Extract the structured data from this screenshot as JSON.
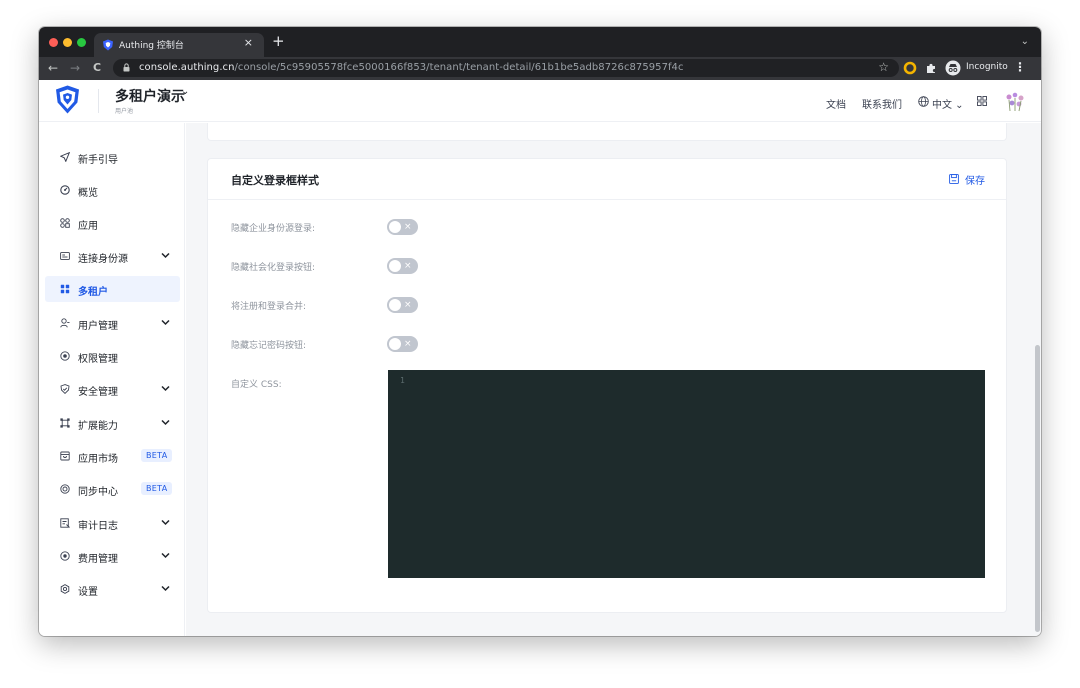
{
  "browser": {
    "tab_title": "Authing 控制台",
    "tab_close": "×",
    "new_tab": "+",
    "tab_menu": "⌄",
    "back": "←",
    "forward": "→",
    "reload": "C",
    "url_host": "console.authing.cn",
    "url_path": "/console/5c95905578fce5000166f853/tenant/tenant-detail/61b1be5adb8726c875957f4c",
    "bookmark_star": "☆",
    "incognito_label": "Incognito",
    "menu": "⋮"
  },
  "header": {
    "pool_name": "多租户演示",
    "pool_caret": "⌄",
    "pool_sub": "用户池",
    "docs_link": "文档",
    "contact_link": "联系我们",
    "language": "中文 ⌄"
  },
  "sidebar": {
    "items": [
      {
        "label": "新手引导",
        "icon": "send-icon"
      },
      {
        "label": "概览",
        "icon": "dashboard-icon"
      },
      {
        "label": "应用",
        "icon": "apps-icon"
      },
      {
        "label": "连接身份源",
        "icon": "id-card-icon",
        "expandable": true
      },
      {
        "label": "多租户",
        "icon": "grid-icon",
        "active": true
      },
      {
        "label": "用户管理",
        "icon": "users-icon",
        "expandable": true
      },
      {
        "label": "权限管理",
        "icon": "target-icon"
      },
      {
        "label": "安全管理",
        "icon": "shield-icon",
        "expandable": true
      },
      {
        "label": "扩展能力",
        "icon": "extend-icon",
        "expandable": true
      },
      {
        "label": "应用市场",
        "icon": "store-icon",
        "badge": "BETA"
      },
      {
        "label": "同步中心",
        "icon": "sync-icon",
        "badge": "BETA"
      },
      {
        "label": "审计日志",
        "icon": "log-icon",
        "expandable": true
      },
      {
        "label": "费用管理",
        "icon": "coin-icon",
        "expandable": true
      },
      {
        "label": "设置",
        "icon": "gear-icon",
        "expandable": true
      }
    ]
  },
  "card": {
    "title": "自定义登录框样式",
    "save_label": "保存",
    "fields": [
      {
        "label": "隐藏企业身份源登录:",
        "value": false
      },
      {
        "label": "隐藏社会化登录按钮:",
        "value": false
      },
      {
        "label": "将注册和登录合并:",
        "value": false
      },
      {
        "label": "隐藏忘记密码按钮:",
        "value": false
      }
    ],
    "toggle_off_glyph": "×",
    "css_label": "自定义 CSS:",
    "editor_line_number": "1"
  },
  "colors": {
    "accent": "#215ae5",
    "editor_bg": "#1e2b2c",
    "toggle_off": "#c1c6cf"
  }
}
